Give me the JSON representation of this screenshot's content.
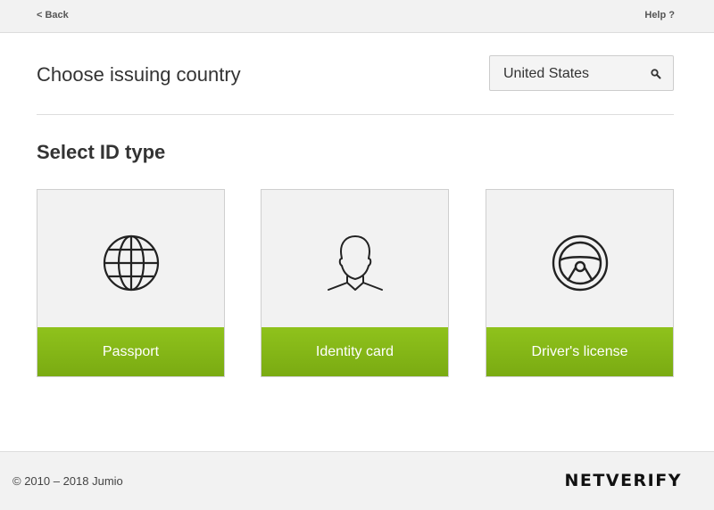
{
  "header": {
    "back_label": "< Back",
    "help_label": "Help ?"
  },
  "country": {
    "title": "Choose issuing country",
    "selected": "United States",
    "icon": "search-icon"
  },
  "id_type": {
    "title": "Select ID type",
    "options": [
      {
        "label": "Passport",
        "icon": "globe-icon"
      },
      {
        "label": "Identity card",
        "icon": "person-icon"
      },
      {
        "label": "Driver's license",
        "icon": "steering-wheel-icon"
      }
    ]
  },
  "footer": {
    "copyright": "© 2010 – 2018 Jumio",
    "brand": "NETVERIFY"
  },
  "colors": {
    "accent": "#86b817",
    "background": "#f2f2f2"
  }
}
